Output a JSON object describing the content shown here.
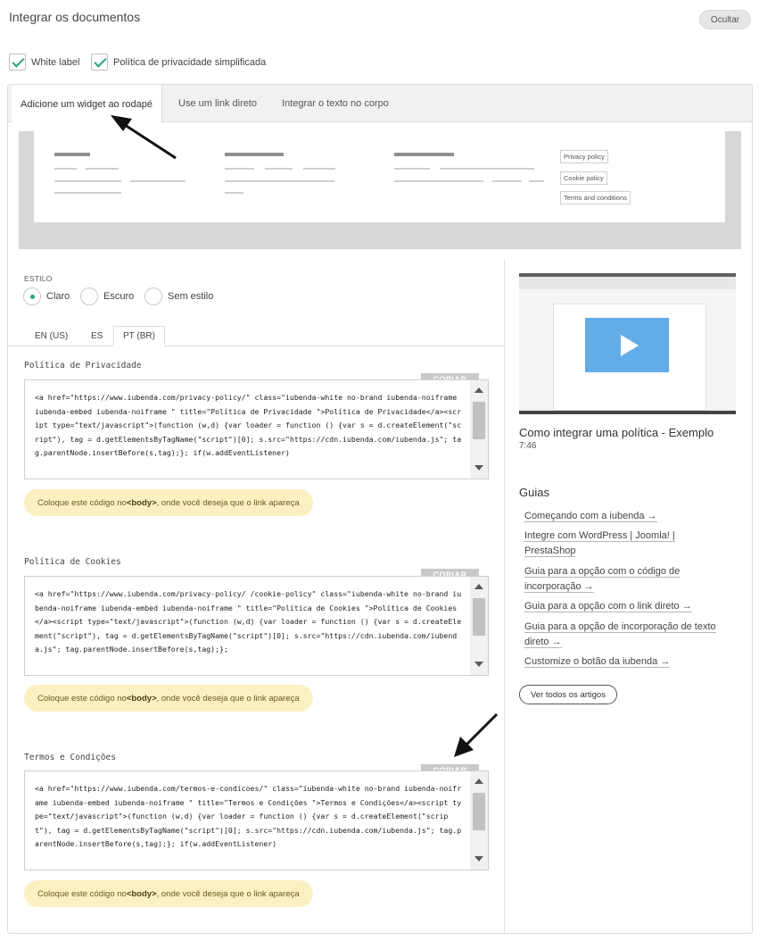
{
  "header": {
    "title": "Integrar os documentos",
    "hide_label": "Ocultar"
  },
  "options": [
    {
      "label": "White label",
      "checked": true
    },
    {
      "label": "Política de privacidade simplificada",
      "checked": true
    }
  ],
  "tabs": [
    {
      "label": "Adicione um widget ao rodapé",
      "active": true
    },
    {
      "label": "Use um link direto",
      "active": false
    },
    {
      "label": "Integrar o texto no corpo",
      "active": false
    }
  ],
  "preview": {
    "links": [
      "Privacy policy",
      "Cookie policy",
      "Terms and conditions"
    ]
  },
  "style": {
    "label": "ESTILO",
    "options": [
      {
        "label": "Claro",
        "selected": true
      },
      {
        "label": "Escuro",
        "selected": false
      },
      {
        "label": "Sem estilo",
        "selected": false
      }
    ]
  },
  "languages": [
    {
      "label": "EN (US)",
      "active": false
    },
    {
      "label": "ES",
      "active": false
    },
    {
      "label": "PT (BR)",
      "active": true
    }
  ],
  "sections": [
    {
      "title": "Política de Privacidade",
      "copy_label": "COPIAR",
      "code": "<a href=\"https://www.iubenda.com/privacy-policy/\" class=\"iubenda-white no-brand iubenda-noiframe iubenda-embed iubenda-noiframe \" title=\"Política de Privacidade \">Política de Privacidade</a><script type=\"text/javascript\">(function (w,d) {var loader = function () {var s = d.createElement(\"script\"), tag = d.getElementsByTagName(\"script\")[0]; s.src=\"https://cdn.iubenda.com/iubenda.js\"; tag.parentNode.insertBefore(s,tag);}; if(w.addEventListener)",
      "hint_before": "Coloque este código no ",
      "hint_tag": "<body>",
      "hint_after": ", onde você deseja que o link apareça"
    },
    {
      "title": "Política de Cookies",
      "copy_label": "COPIAR",
      "code": "<a href=\"https://www.iubenda.com/privacy-policy/ /cookie-policy\" class=\"iubenda-white no-brand iubenda-noiframe iubenda-embed iubenda-noiframe \" title=\"Política de Cookies \">Política de Cookies</a><script type=\"text/javascript\">(function (w,d) {var loader = function () {var s = d.createElement(\"script\"), tag = d.getElementsByTagName(\"script\")[0]; s.src=\"https://cdn.iubenda.com/iubenda.js\"; tag.parentNode.insertBefore(s,tag);};",
      "hint_before": "Coloque este código no ",
      "hint_tag": "<body>",
      "hint_after": ", onde você deseja que o link apareça"
    },
    {
      "title": "Termos e Condições",
      "copy_label": "COPIAR",
      "code": "<a href=\"https://www.iubenda.com/termos-e-condicoes/\" class=\"iubenda-white no-brand iubenda-noiframe iubenda-embed iubenda-noiframe \" title=\"Termos e Condições \">Termos e Condições</a><script type=\"text/javascript\">(function (w,d) {var loader = function () {var s = d.createElement(\"script\"), tag = d.getElementsByTagName(\"script\")[0]; s.src=\"https://cdn.iubenda.com/iubenda.js\"; tag.parentNode.insertBefore(s,tag);}; if(w.addEventListener)",
      "hint_before": "Coloque este código no ",
      "hint_tag": "<body>",
      "hint_after": ", onde você deseja que o link apareça"
    }
  ],
  "video": {
    "title": "Como integrar uma política - Exemplo",
    "duration": "7:46"
  },
  "guides": {
    "title": "Guias",
    "items": [
      {
        "text": "Começando com a iubenda →"
      },
      {
        "text": "Integre com WordPress | Joomla! | PrestaShop"
      },
      {
        "text": "Guia para a opção com o código de incorporação →"
      },
      {
        "text": "Guia para a opção com o link direto →"
      },
      {
        "text": "Guia para a opção de incorporação de texto direto →"
      },
      {
        "text": "Customize o botão da iubenda →"
      }
    ],
    "all_label": "Ver todos os artigos"
  },
  "colors": {
    "accent_green": "#2aa36f",
    "hint_bg": "#fcefc1",
    "play_blue": "#5aa9e6"
  }
}
